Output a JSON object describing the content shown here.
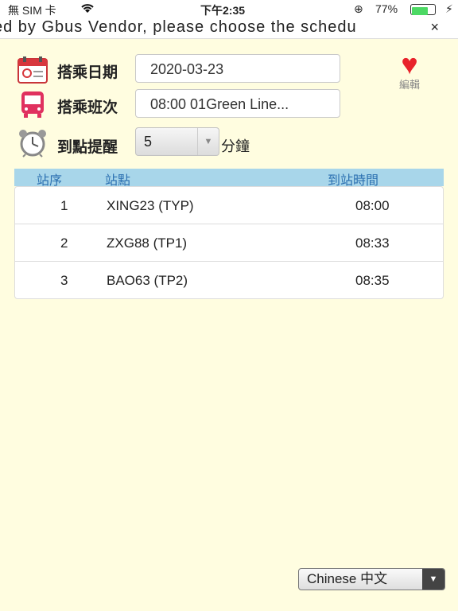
{
  "status_bar": {
    "carrier": "無 SIM 卡",
    "time": "下午2:35",
    "battery_pct": "77%",
    "battery_level": 0.77
  },
  "banner": {
    "text": "ed by Gbus Vendor, please choose the schedu",
    "close": "×"
  },
  "form": {
    "date_label": "搭乘日期",
    "date_value": "2020-03-23",
    "route_label": "搭乘班次",
    "route_value": "08:00 01Green Line...",
    "reminder_label": "到點提醒",
    "reminder_value": "5",
    "reminder_unit": "分鐘"
  },
  "favorite": {
    "label": "編輯"
  },
  "table": {
    "headers": [
      "站序",
      "站點",
      "到站時間"
    ],
    "rows": [
      {
        "seq": "1",
        "stop": "XING23 (TYP)",
        "time": "08:00"
      },
      {
        "seq": "2",
        "stop": "ZXG88 (TP1)",
        "time": "08:33"
      },
      {
        "seq": "3",
        "stop": "BAO63 (TP2)",
        "time": "08:35"
      }
    ]
  },
  "language": {
    "selected": "Chinese 中文"
  },
  "icons": {
    "date": "calendar-icon",
    "route": "bus-icon",
    "reminder": "alarm-clock-icon",
    "favorite": "heart-icon"
  }
}
